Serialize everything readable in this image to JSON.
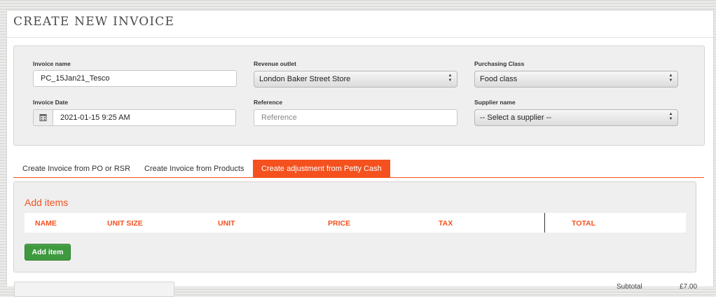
{
  "page": {
    "title": "CREATE NEW INVOICE"
  },
  "form": {
    "invoice_name": {
      "label": "Invoice name",
      "value": "PC_15Jan21_Tesco"
    },
    "revenue_outlet": {
      "label": "Revenue outlet",
      "value": "London Baker Street Store"
    },
    "purchasing_class": {
      "label": "Purchasing Class",
      "value": "Food class"
    },
    "invoice_date": {
      "label": "Invoice Date",
      "value": "2021-01-15 9:25 AM"
    },
    "reference": {
      "label": "Reference",
      "placeholder": "Reference",
      "value": ""
    },
    "supplier_name": {
      "label": "Supplier name",
      "value": "-- Select a supplier --"
    }
  },
  "tabs": [
    {
      "label": "Create Invoice from PO or RSR",
      "active": false
    },
    {
      "label": "Create Invoice from Products",
      "active": false
    },
    {
      "label": "Create adjustment from Petty Cash",
      "active": true
    }
  ],
  "items": {
    "title": "Add items",
    "columns": [
      "NAME",
      "UNIT SIZE",
      "UNIT",
      "PRICE",
      "TAX",
      "TOTAL"
    ],
    "add_button": "Add item"
  },
  "footer": {
    "subtotal_label": "Subtotal",
    "subtotal_value": "£7.00"
  },
  "colors": {
    "accent": "#f4511e",
    "button_green": "#3f9a3f",
    "panel_bg": "#efefef"
  },
  "icons": {
    "calendar": "calendar-icon",
    "select": "select-arrows-icon"
  }
}
